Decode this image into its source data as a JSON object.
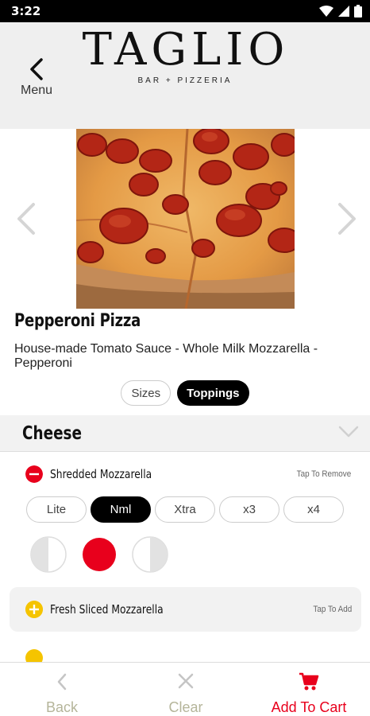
{
  "status_bar": {
    "time": "3:22"
  },
  "header": {
    "back_label": "Menu",
    "brand_title": "TAGLIO",
    "brand_subtitle": "BAR + PIZZERIA"
  },
  "item": {
    "name": "Pepperoni Pizza",
    "description": "House-made Tomato Sauce - Whole Milk Mozzarella - Pepperoni"
  },
  "tabs": [
    {
      "label": "Sizes",
      "active": false
    },
    {
      "label": "Toppings",
      "active": true
    }
  ],
  "section": {
    "title": "Cheese"
  },
  "toppings": [
    {
      "name": "Shredded Mozzarella",
      "action": "Tap To Remove",
      "selected": true
    },
    {
      "name": "Fresh Sliced Mozzarella",
      "action": "Tap To Add",
      "selected": false
    }
  ],
  "amounts": [
    {
      "label": "Lite",
      "active": false
    },
    {
      "label": "Nml",
      "active": true
    },
    {
      "label": "Xtra",
      "active": false
    },
    {
      "label": "x3",
      "active": false
    },
    {
      "label": "x4",
      "active": false
    }
  ],
  "portions": [
    "left-half",
    "whole",
    "right-half"
  ],
  "bottom_bar": {
    "back_label": "Back",
    "clear_label": "Clear",
    "add_to_cart_label": "Add To Cart"
  },
  "colors": {
    "accent_red": "#e8001c",
    "add_yellow": "#f5c400",
    "active_black": "#000000",
    "muted_gray": "#b5b59a"
  },
  "icons": [
    "wifi-icon",
    "signal-icon",
    "battery-icon",
    "chevron-left-icon",
    "chevron-right-icon",
    "chevron-down-icon",
    "minus-circle-icon",
    "plus-circle-icon",
    "close-icon",
    "cart-icon"
  ]
}
